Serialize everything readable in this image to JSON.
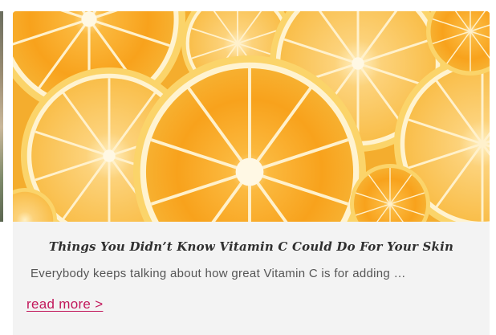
{
  "card": {
    "title": "Things You Didn’t Know Vitamin C Could Do For Your Skin",
    "excerpt": "Everybody keeps talking about how great Vitamin C is for adding …",
    "read_more": "read more >",
    "image_subject": "orange-slices-image"
  },
  "colors": {
    "card_background": "#f3f3f3",
    "title_text": "#2f2f2f",
    "excerpt_text": "#555555",
    "link_accent": "#c2185b",
    "orange_pulp": "#f7a21b",
    "orange_rind": "#fbd77a",
    "pith": "#fff4d6"
  }
}
